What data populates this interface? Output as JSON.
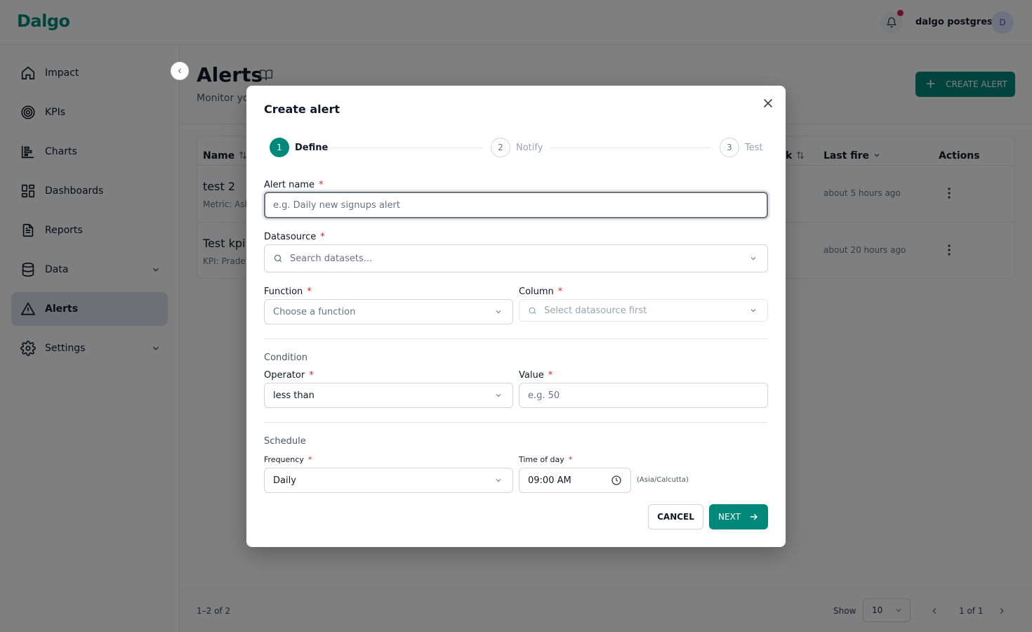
{
  "app": {
    "logo_text": "Dalgo",
    "user_name": "dalgo postgres",
    "avatar_initial": "D"
  },
  "sidebar": {
    "items": [
      {
        "label": "Impact",
        "icon": "home-icon"
      },
      {
        "label": "KPIs",
        "icon": "target-icon"
      },
      {
        "label": "Charts",
        "icon": "chart-icon"
      },
      {
        "label": "Dashboards",
        "icon": "dashboard-icon"
      },
      {
        "label": "Reports",
        "icon": "report-icon"
      },
      {
        "label": "Data",
        "icon": "database-icon",
        "expandable": true
      },
      {
        "label": "Alerts",
        "icon": "alert-icon",
        "active": true
      },
      {
        "label": "Settings",
        "icon": "gear-icon",
        "expandable": true
      }
    ]
  },
  "page": {
    "title": "Alerts",
    "subtitle": "Monitor yo",
    "create_button": "CREATE ALERT"
  },
  "table": {
    "columns": {
      "name": "Name",
      "partial": "k",
      "last_fire": "Last fire",
      "actions": "Actions"
    },
    "rows": [
      {
        "name": "test 2",
        "sub": "Metric: Ash",
        "last_fire": "about 5 hours ago"
      },
      {
        "name": "Test kpi",
        "sub": "KPI: Prade",
        "last_fire": "about 20 hours ago"
      }
    ]
  },
  "pagination": {
    "count": "1–2 of 2",
    "show_label": "Show",
    "page_size": "10",
    "page": "1 of 1"
  },
  "modal": {
    "title": "Create alert",
    "steps": [
      {
        "number": "1",
        "label": "Define",
        "active": true
      },
      {
        "number": "2",
        "label": "Notify",
        "active": false
      },
      {
        "number": "3",
        "label": "Test",
        "active": false
      }
    ],
    "alert_name": {
      "label": "Alert name",
      "placeholder": "e.g. Daily new signups alert",
      "value": ""
    },
    "datasource": {
      "label": "Datasource",
      "placeholder": "Search datasets..."
    },
    "function": {
      "label": "Function",
      "placeholder": "Choose a function"
    },
    "column": {
      "label": "Column",
      "placeholder": "Select datasource first"
    },
    "condition": {
      "title": "Condition",
      "operator_label": "Operator",
      "operator_value": "less than",
      "value_label": "Value",
      "value_placeholder": "e.g. 50"
    },
    "schedule": {
      "title": "Schedule",
      "frequency_label": "Frequency",
      "frequency_value": "Daily",
      "time_label": "Time of day",
      "time_value": "09:00 AM",
      "timezone": "(Asia/Calcutta)"
    },
    "buttons": {
      "cancel": "CANCEL",
      "next": "NEXT"
    },
    "required_mark": "*"
  },
  "colors": {
    "brand": "#00897b",
    "required": "#dc2626",
    "notification_dot": "#e11d48"
  }
}
